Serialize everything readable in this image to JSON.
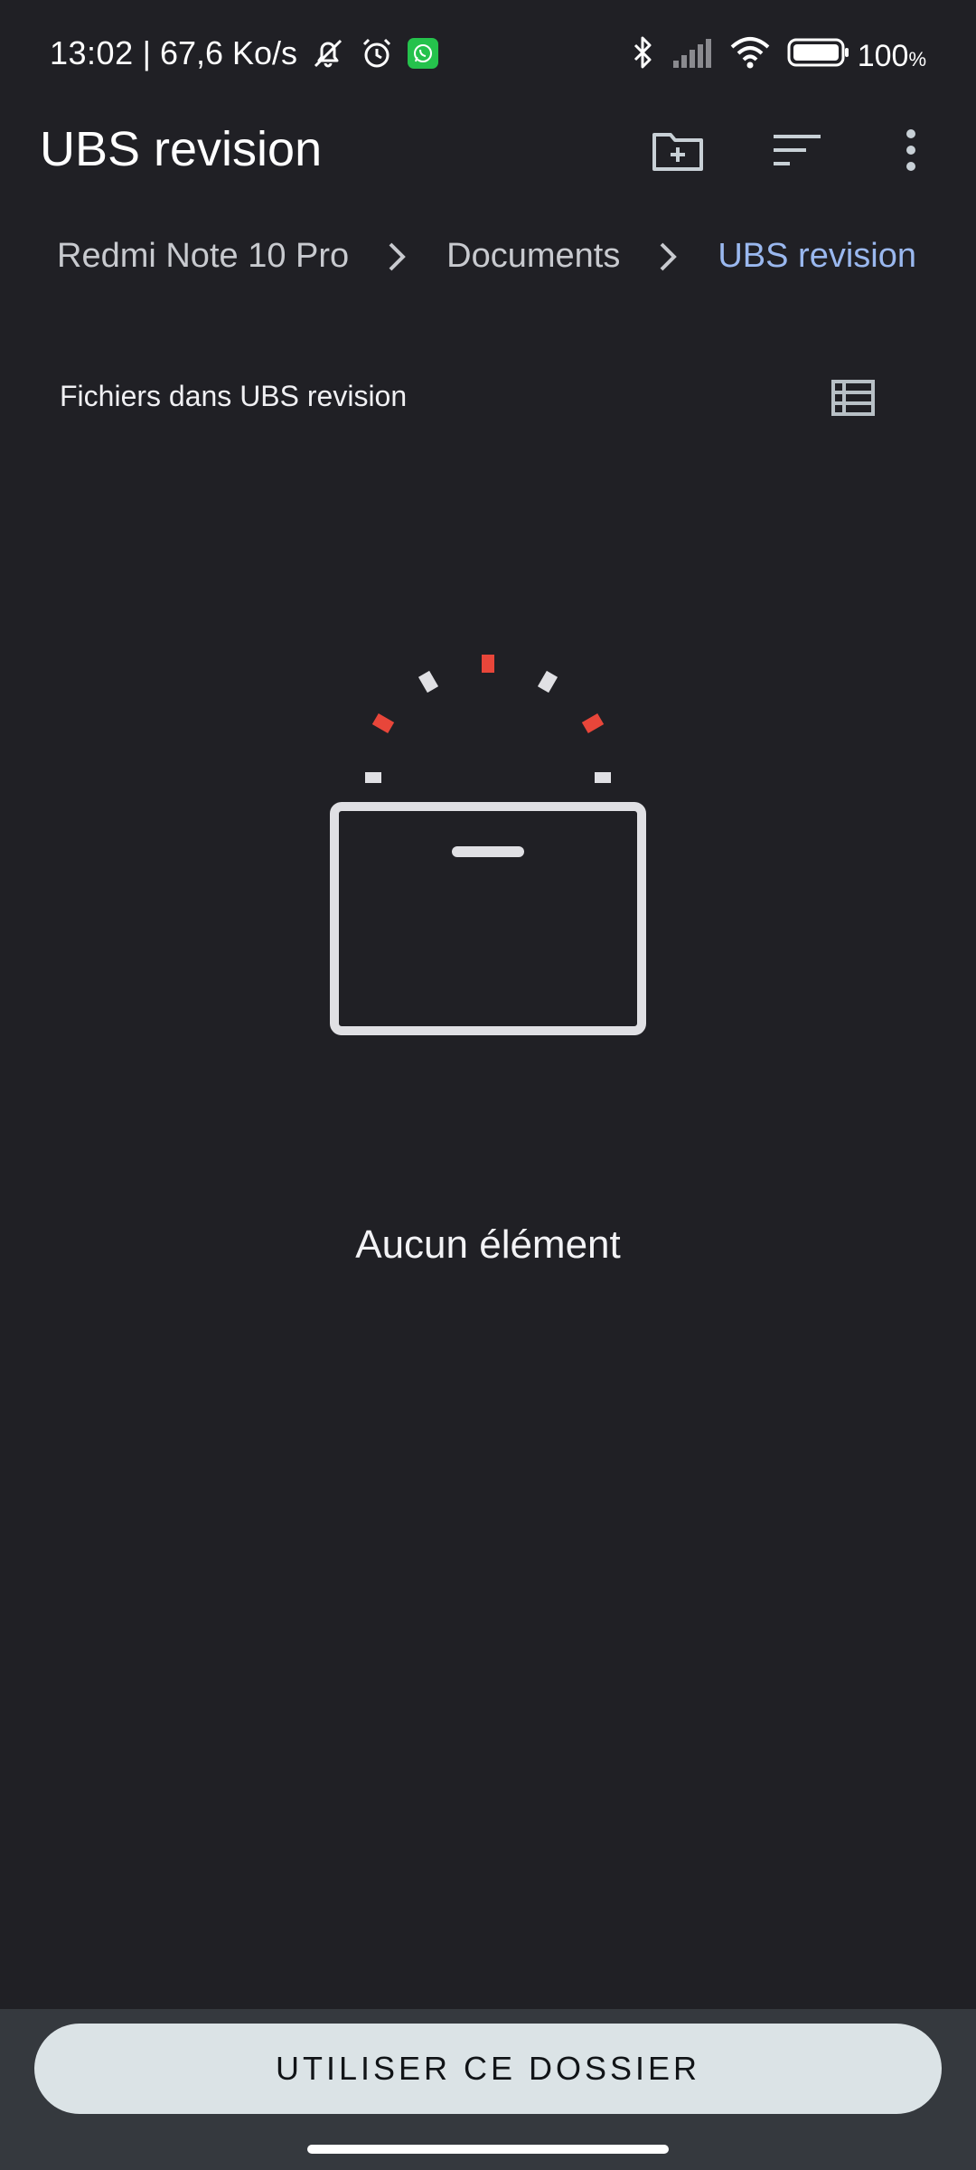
{
  "status_bar": {
    "time": "13:02",
    "separator": "|",
    "network_speed": "67,6 Ko/s",
    "battery_percent": "100",
    "battery_unit": "%",
    "icons": [
      "bell-off-icon",
      "alarm-icon",
      "whatsapp-icon",
      "bluetooth-icon",
      "signal-icon",
      "wifi-icon",
      "battery-icon"
    ]
  },
  "app_bar": {
    "title": "UBS revision",
    "actions": [
      "new-folder-icon",
      "sort-icon",
      "more-vert-icon"
    ]
  },
  "breadcrumb": {
    "items": [
      "Redmi Note 10 Pro",
      "Documents",
      "UBS revision"
    ],
    "current_color": "#9ab8ef"
  },
  "files_header": {
    "label": "Fichiers dans UBS revision",
    "view_icon": "list-view-icon"
  },
  "empty_state": {
    "message": "Aucun élément",
    "icon": "empty-box-icon",
    "accent_color": "#e8463a"
  },
  "bottom_bar": {
    "button_label": "UTILISER CE DOSSIER"
  },
  "colors": {
    "background": "#202025",
    "button_bg": "#dbe3e6",
    "bottom_bar_bg": "#35393e"
  }
}
